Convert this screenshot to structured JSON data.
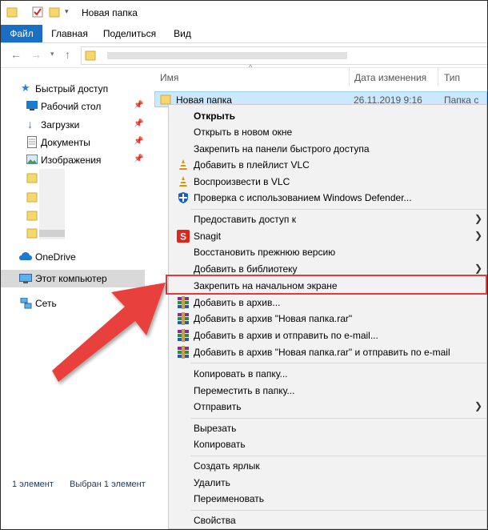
{
  "window": {
    "title": "Новая папка"
  },
  "ribbon": {
    "tabs": [
      "Файл",
      "Главная",
      "Поделиться",
      "Вид"
    ]
  },
  "columns": {
    "name": "Имя",
    "date": "Дата изменения",
    "type": "Тип"
  },
  "file": {
    "name": "Новая папка",
    "date": "26.11.2019 9:16",
    "type": "Папка с фа"
  },
  "nav": {
    "quick_access": "Быстрый доступ",
    "desktop": "Рабочий стол",
    "downloads": "Загрузки",
    "documents": "Документы",
    "pictures": "Изображения",
    "onedrive": "OneDrive",
    "this_pc": "Этот компьютер",
    "network": "Сеть"
  },
  "status": {
    "count": "1 элемент",
    "selected": "Выбран 1 элемент"
  },
  "menu": {
    "open": "Открыть",
    "open_new_window": "Открыть в новом окне",
    "pin_quick": "Закрепить на панели быстрого доступа",
    "vlc_playlist": "Добавить в плейлист VLC",
    "vlc_play": "Воспроизвести в VLC",
    "defender": "Проверка с использованием Windows Defender...",
    "share": "Предоставить доступ к",
    "snagit": "Snagit",
    "restore": "Восстановить прежнюю версию",
    "library": "Добавить в библиотеку",
    "pin_start": "Закрепить на начальном экране",
    "add_archive": "Добавить в архив...",
    "add_rar": "Добавить в архив \"Новая папка.rar\"",
    "add_email": "Добавить в архив и отправить по e-mail...",
    "add_rar_email": "Добавить в архив \"Новая папка.rar\" и отправить по e-mail",
    "copy_to": "Копировать в папку...",
    "move_to": "Переместить в папку...",
    "send_to": "Отправить",
    "cut": "Вырезать",
    "copy": "Копировать",
    "shortcut": "Создать ярлык",
    "delete": "Удалить",
    "rename": "Переименовать",
    "properties": "Свойства"
  },
  "colors": {
    "accent": "#1a6fc2",
    "highlight": "#e53939",
    "selection": "#cce8ff"
  }
}
